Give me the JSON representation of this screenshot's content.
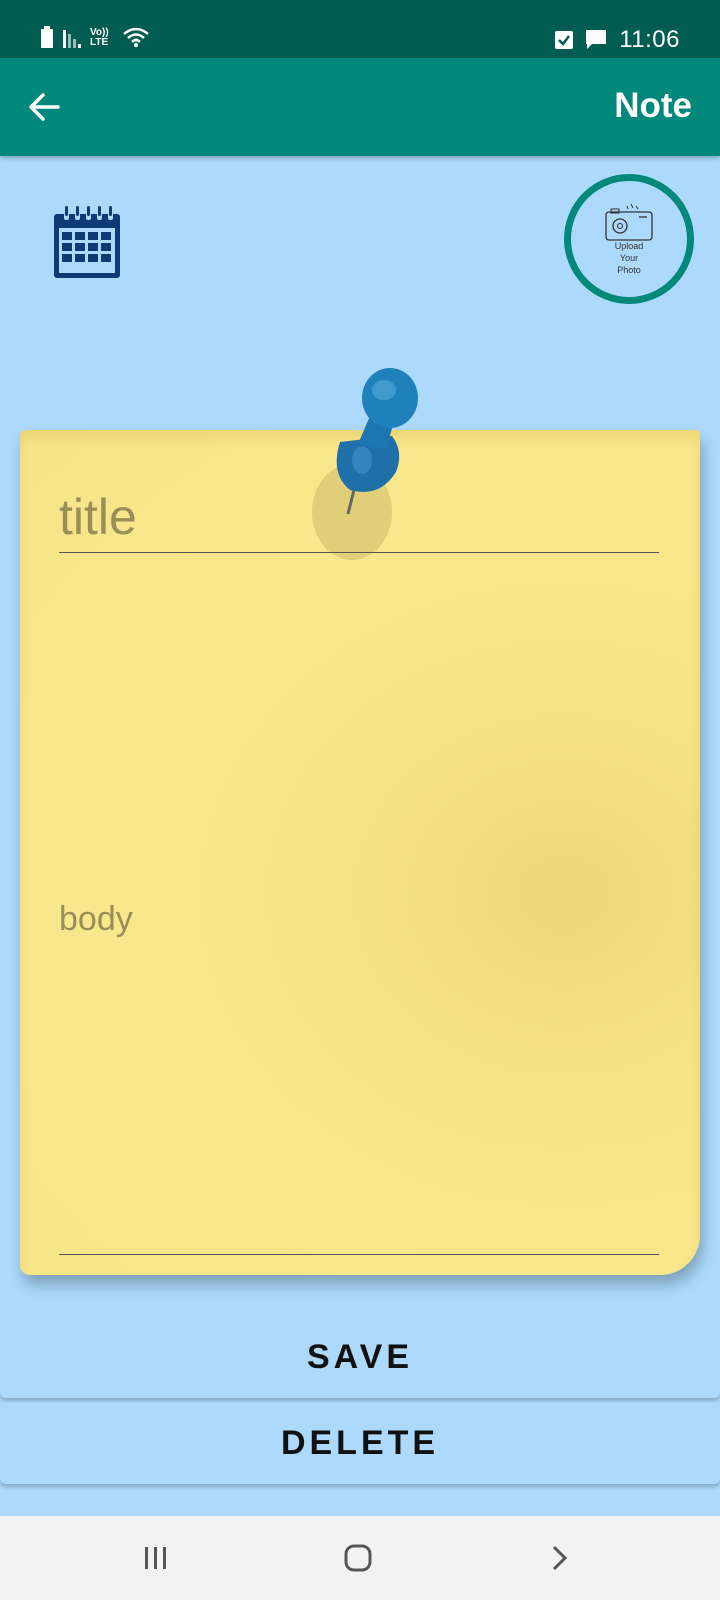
{
  "status_bar": {
    "time": "11:06",
    "network_label": "Vo)) LTE",
    "icons": [
      "battery-icon",
      "signal-icon",
      "volte-icon",
      "wifi-icon",
      "checkbox-notification-icon",
      "message-notification-icon"
    ]
  },
  "app_bar": {
    "title": "Note",
    "back_icon": "arrow-left-icon"
  },
  "toolbar": {
    "calendar_icon": "calendar-icon",
    "photo_label_line1": "Upload",
    "photo_label_line2": "Your",
    "photo_label_line3": "Photo",
    "accent_color": "#00897b"
  },
  "note": {
    "title_placeholder": "title",
    "body_placeholder": "body",
    "paper_color": "#f8e78c"
  },
  "actions": {
    "save_label": "SAVE",
    "delete_label": "DELETE"
  },
  "nav_bar": {
    "icons": [
      "recent-apps-icon",
      "home-icon",
      "back-icon"
    ]
  }
}
